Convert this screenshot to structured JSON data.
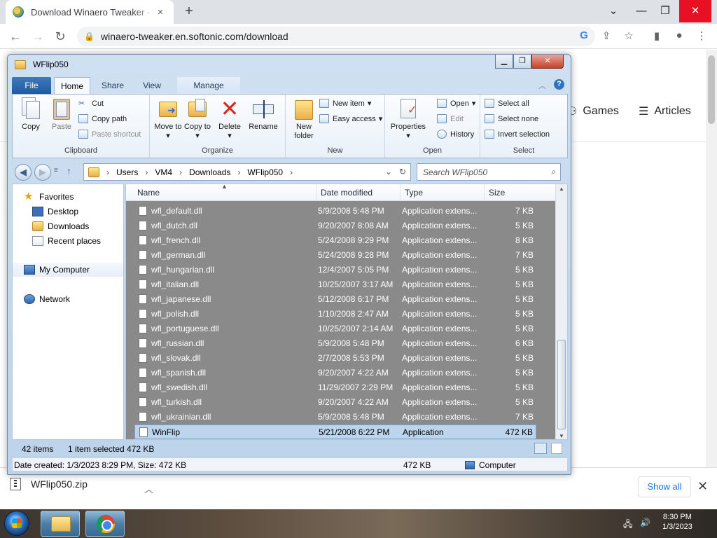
{
  "browser": {
    "tab_title": "Download Winaero Tweaker - fre",
    "tab_close": "×",
    "new_tab": "+",
    "url": "winaero-tweaker.en.softonic.com/download",
    "window_controls": {
      "chevron": "⌄",
      "minimize": "—",
      "restore": "❐",
      "close": "✕"
    }
  },
  "page": {
    "nav_games": "Games",
    "nav_articles": "Articles"
  },
  "download_bar": {
    "file": "WFlip050.zip",
    "show_all": "Show all"
  },
  "explorer": {
    "title": "WFlip050",
    "ribbon_tabs": {
      "file": "File",
      "home": "Home",
      "share": "Share",
      "view": "View",
      "manage": "Manage"
    },
    "clipboard": {
      "copy": "Copy",
      "paste": "Paste",
      "cut": "Cut",
      "copy_path": "Copy path",
      "paste_shortcut": "Paste shortcut",
      "label": "Clipboard"
    },
    "organize": {
      "move_to": "Move to",
      "copy_to": "Copy to",
      "delete": "Delete",
      "rename": "Rename",
      "label": "Organize"
    },
    "new": {
      "new_folder": "New folder",
      "new_item": "New item",
      "easy_access": "Easy access",
      "label": "New"
    },
    "open": {
      "properties": "Properties",
      "open": "Open",
      "edit": "Edit",
      "history": "History",
      "label": "Open"
    },
    "select": {
      "select_all": "Select all",
      "select_none": "Select none",
      "invert": "Invert selection",
      "label": "Select"
    },
    "address": {
      "crumbs": [
        "Users",
        "VM4",
        "Downloads",
        "WFlip050"
      ]
    },
    "search_placeholder": "Search WFlip050",
    "nav_pane": {
      "favorites": "Favorites",
      "desktop": "Desktop",
      "downloads": "Downloads",
      "recent": "Recent places",
      "computer": "My Computer",
      "network": "Network"
    },
    "columns": {
      "name": "Name",
      "date": "Date modified",
      "type": "Type",
      "size": "Size"
    },
    "files": [
      {
        "name": "wfl_default.dll",
        "date": "5/9/2008 5:48 PM",
        "type": "Application extens...",
        "size": "7 KB"
      },
      {
        "name": "wfl_dutch.dll",
        "date": "9/20/2007 8:08 AM",
        "type": "Application extens...",
        "size": "5 KB"
      },
      {
        "name": "wfl_french.dll",
        "date": "5/24/2008 9:29 PM",
        "type": "Application extens...",
        "size": "8 KB"
      },
      {
        "name": "wfl_german.dll",
        "date": "5/24/2008 9:28 PM",
        "type": "Application extens...",
        "size": "7 KB"
      },
      {
        "name": "wfl_hungarian.dll",
        "date": "12/4/2007 5:05 PM",
        "type": "Application extens...",
        "size": "5 KB"
      },
      {
        "name": "wfl_italian.dll",
        "date": "10/25/2007 3:17 AM",
        "type": "Application extens...",
        "size": "5 KB"
      },
      {
        "name": "wfl_japanese.dll",
        "date": "5/12/2008 6:17 PM",
        "type": "Application extens...",
        "size": "5 KB"
      },
      {
        "name": "wfl_polish.dll",
        "date": "1/10/2008 2:47 AM",
        "type": "Application extens...",
        "size": "5 KB"
      },
      {
        "name": "wfl_portuguese.dll",
        "date": "10/25/2007 2:14 AM",
        "type": "Application extens...",
        "size": "5 KB"
      },
      {
        "name": "wfl_russian.dll",
        "date": "5/9/2008 5:48 PM",
        "type": "Application extens...",
        "size": "6 KB"
      },
      {
        "name": "wfl_slovak.dll",
        "date": "2/7/2008 5:53 PM",
        "type": "Application extens...",
        "size": "5 KB"
      },
      {
        "name": "wfl_spanish.dll",
        "date": "9/20/2007 4:22 AM",
        "type": "Application extens...",
        "size": "5 KB"
      },
      {
        "name": "wfl_swedish.dll",
        "date": "11/29/2007 2:29 PM",
        "type": "Application extens...",
        "size": "5 KB"
      },
      {
        "name": "wfl_turkish.dll",
        "date": "9/20/2007 4:22 AM",
        "type": "Application extens...",
        "size": "5 KB"
      },
      {
        "name": "wfl_ukrainian.dll",
        "date": "5/9/2008 5:48 PM",
        "type": "Application extens...",
        "size": "7 KB"
      },
      {
        "name": "WinFlip",
        "date": "5/21/2008 6:22 PM",
        "type": "Application",
        "size": "472 KB"
      }
    ],
    "status": {
      "items": "42 items",
      "selected": "1 item selected",
      "selected_size": "472 KB"
    },
    "details": {
      "created": "Date created: 1/3/2023 8:29 PM, Size: 472 KB",
      "size": "472 KB",
      "zone": "Computer"
    }
  },
  "taskbar": {
    "time": "8:30 PM",
    "date": "1/3/2023"
  }
}
